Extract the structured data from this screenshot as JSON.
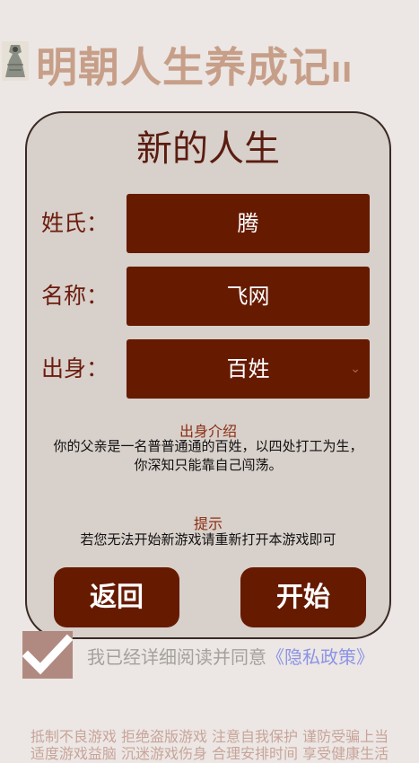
{
  "header": {
    "title": "明朝人生养成记",
    "title_suffix": "II"
  },
  "panel": {
    "title": "新的人生",
    "fields": {
      "surname": {
        "label": "姓氏：",
        "value": "腾"
      },
      "given_name": {
        "label": "名称：",
        "value": "飞网"
      },
      "origin": {
        "label": "出身：",
        "value": "百姓"
      }
    },
    "origin_intro": {
      "title": "出身介绍",
      "line1": "你的父亲是一名普普通通的百姓，以四处打工为生，",
      "line2": "你深知只能靠自己闯荡。"
    },
    "tip": {
      "title": "提示",
      "text": "若您无法开始新游戏请重新打开本游戏即可"
    },
    "buttons": {
      "back": "返回",
      "start": "开始"
    }
  },
  "agreement": {
    "text": "我已经详细阅读并同意",
    "policy": "《隐私政策》",
    "checked": true
  },
  "footer": {
    "line1": "抵制不良游戏 拒绝盗版游戏 注意自我保护 谨防受骗上当",
    "line2": "适度游戏益脑 沉迷游戏伤身 合理安排时间 享受健康生活"
  },
  "colors": {
    "background": "#ece7e4",
    "panel": "#d8d0ca",
    "accent": "#661a00",
    "title": "#c79f89",
    "policy_link": "#8c93e6"
  },
  "icons": {
    "logo": "portrait-logo-icon",
    "check": "checkmark-icon",
    "dropdown": "chevron-down-icon"
  }
}
